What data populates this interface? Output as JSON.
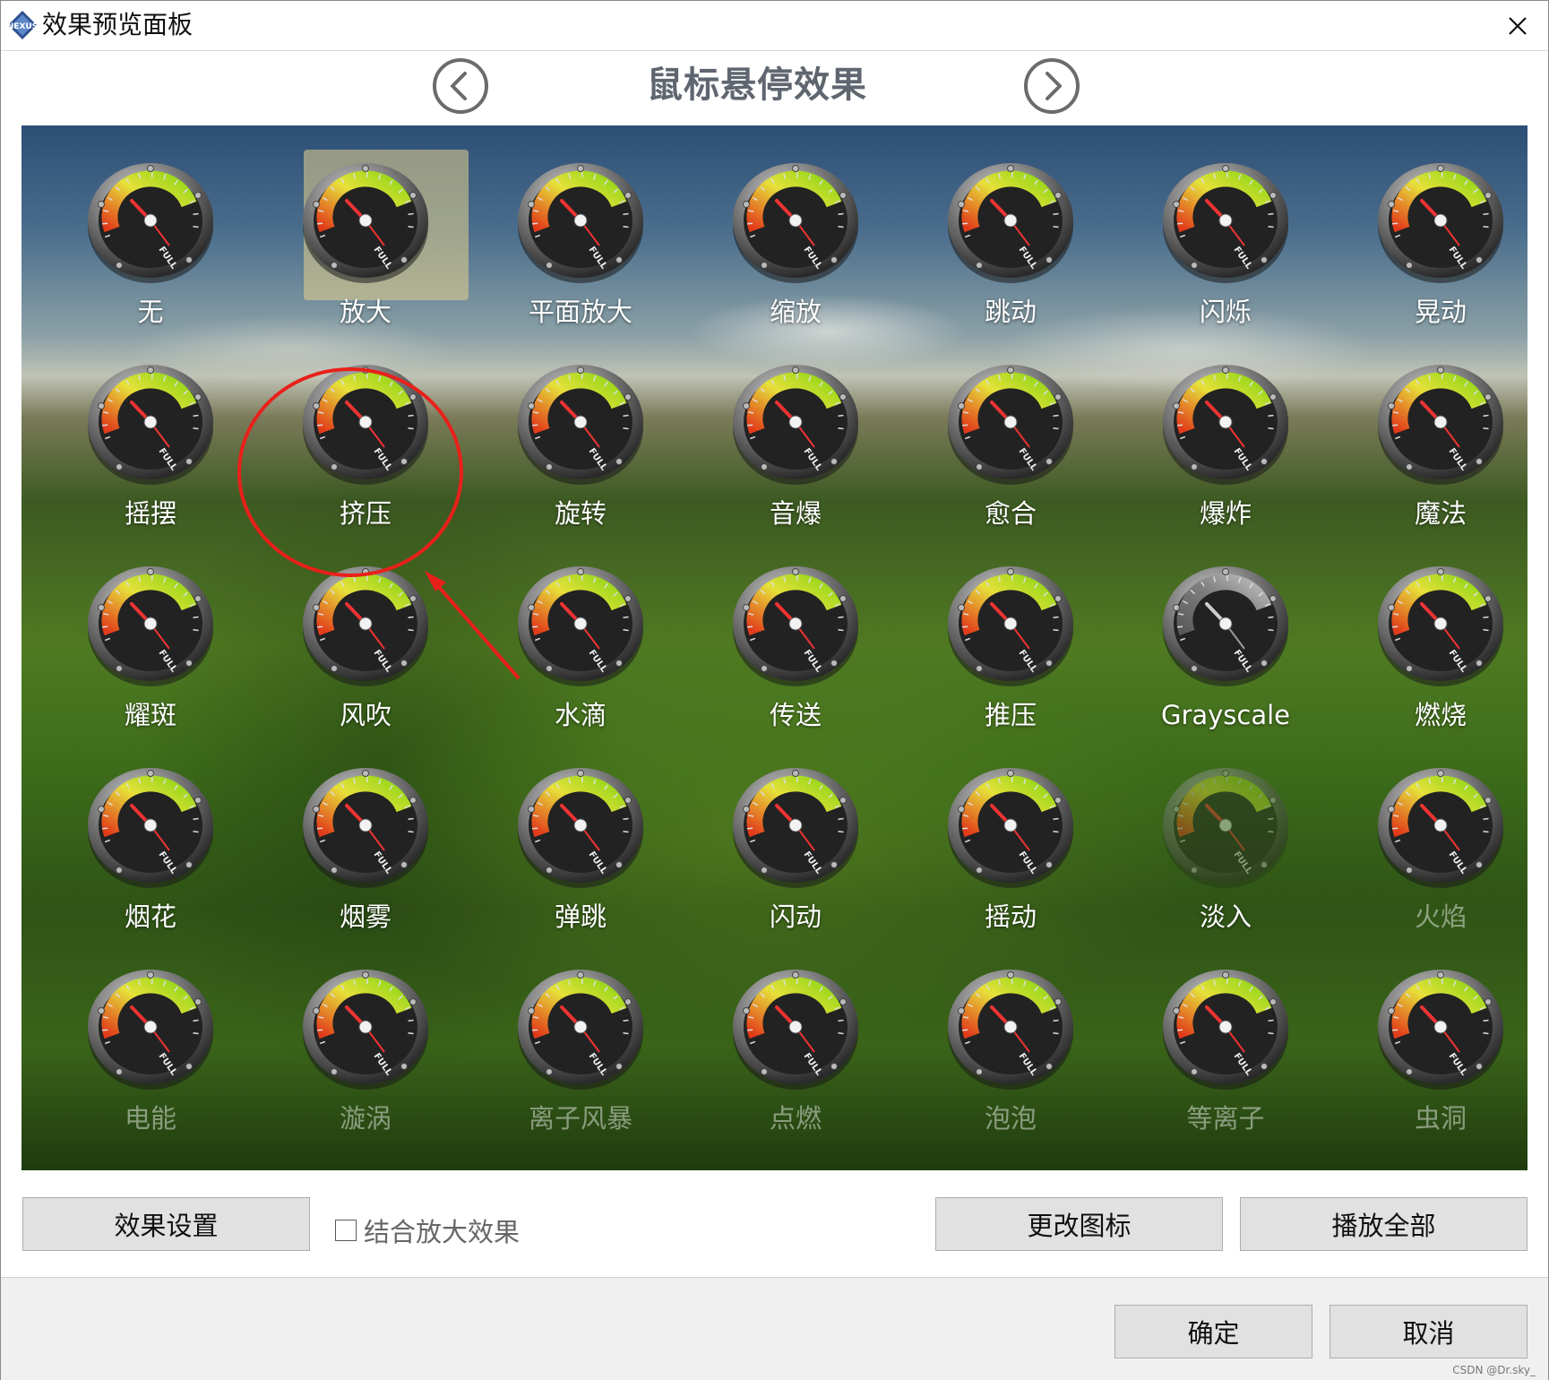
{
  "window": {
    "title": "效果预览面板",
    "logo_text": "NEXUS"
  },
  "header": {
    "title": "鼠标悬停效果",
    "prev_icon": "chevron-left-circle-icon",
    "next_icon": "chevron-right-circle-icon"
  },
  "effects": [
    {
      "label": "无"
    },
    {
      "label": "放大"
    },
    {
      "label": "平面放大"
    },
    {
      "label": "缩放"
    },
    {
      "label": "跳动"
    },
    {
      "label": "闪烁"
    },
    {
      "label": "晃动"
    },
    {
      "label": "摇摆"
    },
    {
      "label": "挤压"
    },
    {
      "label": "旋转"
    },
    {
      "label": "音爆"
    },
    {
      "label": "愈合"
    },
    {
      "label": "爆炸"
    },
    {
      "label": "魔法"
    },
    {
      "label": "耀斑"
    },
    {
      "label": "风吹"
    },
    {
      "label": "水滴"
    },
    {
      "label": "传送"
    },
    {
      "label": "推压"
    },
    {
      "label": "Grayscale"
    },
    {
      "label": "燃烧"
    },
    {
      "label": "烟花"
    },
    {
      "label": "烟雾"
    },
    {
      "label": "弹跳"
    },
    {
      "label": "闪动"
    },
    {
      "label": "摇动"
    },
    {
      "label": "淡入"
    },
    {
      "label": "火焰"
    },
    {
      "label": "电能"
    },
    {
      "label": "漩涡"
    },
    {
      "label": "离子风暴"
    },
    {
      "label": "点燃"
    },
    {
      "label": "泡泡"
    },
    {
      "label": "等离子"
    },
    {
      "label": "虫洞"
    }
  ],
  "gauge_text": "FULL",
  "controls": {
    "effect_settings": "效果设置",
    "combine_zoom": "结合放大效果",
    "combine_zoom_checked": false,
    "change_icon": "更改图标",
    "play_all": "播放全部"
  },
  "footer": {
    "ok": "确定",
    "cancel": "取消"
  },
  "watermark": "CSDN @Dr.sky_",
  "colors": {
    "highlight_circle": "#e8201a",
    "header_title": "#5f6670"
  }
}
